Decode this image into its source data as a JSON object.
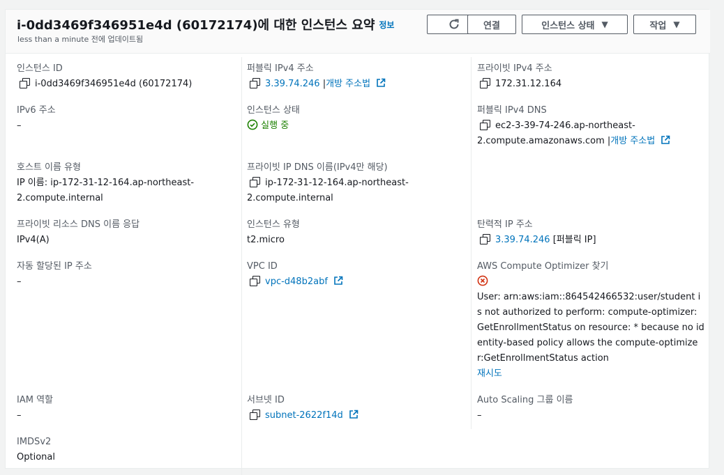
{
  "header": {
    "title": "i-0dd3469f346951e4d (60172174)에 대한 인스턴스 요약",
    "info_link": "정보",
    "subtitle": "less than a minute 전에 업데이트됨",
    "buttons": {
      "refresh_icon": "refresh-icon",
      "connect": "연결",
      "instance_state": "인스턴스 상태",
      "actions": "작업"
    }
  },
  "fields": {
    "instance_id": {
      "label": "인스턴스 ID",
      "value": "i-0dd3469f346951e4d (60172174)"
    },
    "public_ipv4": {
      "label": "퍼블릭 IPv4 주소",
      "value": "3.39.74.246",
      "sep": " |",
      "open_address": "개방 주소법"
    },
    "private_ipv4": {
      "label": "프라이빗 IPv4 주소",
      "value": "172.31.12.164"
    },
    "ipv6": {
      "label": "IPv6 주소",
      "value": "–"
    },
    "instance_state": {
      "label": "인스턴스 상태",
      "value": "실행 중"
    },
    "public_ipv4_dns": {
      "label": "퍼블릭 IPv4 DNS",
      "value_line1": "ec2-3-39-74-246.ap-northeast-",
      "value_line2": "2.compute.amazonaws.com",
      "sep": " |",
      "open_address": "개방 주소법"
    },
    "hostname_type": {
      "label": "호스트 이름 유형",
      "value_line1": "IP 이름: ip-172-31-12-164.ap-northeast-",
      "value_line2": "2.compute.internal"
    },
    "private_ip_dns": {
      "label": "프라이빗 IP DNS 이름(IPv4만 해당)",
      "value_line1": "ip-172-31-12-164.ap-northeast-",
      "value_line2": "2.compute.internal"
    },
    "private_resource_dns": {
      "label": "프라이빗 리소스 DNS 이름 응답",
      "value": "IPv4(A)"
    },
    "instance_type": {
      "label": "인스턴스 유형",
      "value": "t2.micro"
    },
    "elastic_ip": {
      "label": "탄력적 IP 주소",
      "value": "3.39.74.246",
      "suffix": " [퍼블릭 IP]"
    },
    "auto_assigned_ip": {
      "label": "자동 할당된 IP 주소",
      "value": "–"
    },
    "vpc_id": {
      "label": "VPC ID",
      "value": "vpc-d48b2abf"
    },
    "compute_optimizer": {
      "label": "AWS Compute Optimizer 찾기",
      "error_lines": [
        "User: arn:aws:iam::864542466532:user/student i",
        "s not authorized to perform: compute-optimizer:",
        "GetEnrollmentStatus on resource: * because no id",
        "entity-based policy allows the compute-optimize",
        "r:GetEnrollmentStatus action"
      ],
      "retry": "재시도"
    },
    "iam_role": {
      "label": "IAM 역할",
      "value": "–"
    },
    "subnet_id": {
      "label": "서브넷 ID",
      "value": "subnet-2622f14d"
    },
    "auto_scaling": {
      "label": "Auto Scaling 그룹 이름",
      "value": "–"
    },
    "imdsv2": {
      "label": "IMDSv2",
      "value": "Optional"
    }
  },
  "colors": {
    "link": "#0073bb",
    "success": "#1d8102",
    "error": "#d13212"
  }
}
